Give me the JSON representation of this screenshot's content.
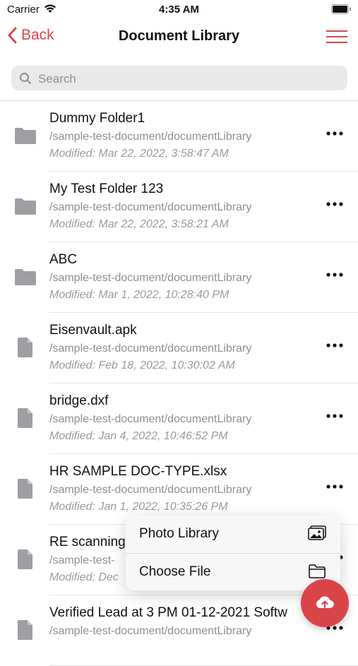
{
  "status": {
    "carrier": "Carrier",
    "time": "4:35 AM"
  },
  "nav": {
    "back_label": "Back",
    "title": "Document Library"
  },
  "search": {
    "placeholder": "Search"
  },
  "items": [
    {
      "type": "folder",
      "title": "Dummy Folder1",
      "path": "/sample-test-document/documentLibrary",
      "modified": "Modified: Mar 22, 2022, 3:58:47 AM"
    },
    {
      "type": "folder",
      "title": "My Test Folder 123",
      "path": "/sample-test-document/documentLibrary",
      "modified": "Modified: Mar 22, 2022, 3:58:21 AM"
    },
    {
      "type": "folder",
      "title": "ABC",
      "path": "/sample-test-document/documentLibrary",
      "modified": "Modified: Mar 1, 2022, 10:28:40 PM"
    },
    {
      "type": "file",
      "title": "Eisenvault.apk",
      "path": "/sample-test-document/documentLibrary",
      "modified": "Modified: Feb 18, 2022, 10:30:02 AM"
    },
    {
      "type": "file",
      "title": "bridge.dxf",
      "path": "/sample-test-document/documentLibrary",
      "modified": "Modified: Jan 4, 2022, 10:46:52 PM"
    },
    {
      "type": "file",
      "title": "HR SAMPLE DOC-TYPE.xlsx",
      "path": "/sample-test-document/documentLibrary",
      "modified": "Modified: Jan 1, 2022, 10:35:26 PM"
    },
    {
      "type": "file",
      "title": "RE scanning",
      "path": "/sample-test-",
      "modified": "Modified: Dec"
    },
    {
      "type": "file",
      "title": "Verified Lead at 3 PM 01-12-2021 Softw",
      "path": "/sample-test-document/documentLibrary",
      "modified": ""
    }
  ],
  "upload_menu": {
    "photo_library_label": "Photo Library",
    "choose_file_label": "Choose File"
  },
  "colors": {
    "accent": "#d9474b",
    "fab": "#d94449"
  },
  "icons": {
    "back": "chevron-left-icon",
    "menu": "hamburger-menu-icon",
    "search": "search-icon",
    "folder": "folder-icon",
    "file": "file-icon",
    "more": "more-horizontal-icon",
    "photo": "photo-library-icon",
    "choose_file": "folder-outline-icon",
    "upload": "cloud-upload-icon"
  }
}
